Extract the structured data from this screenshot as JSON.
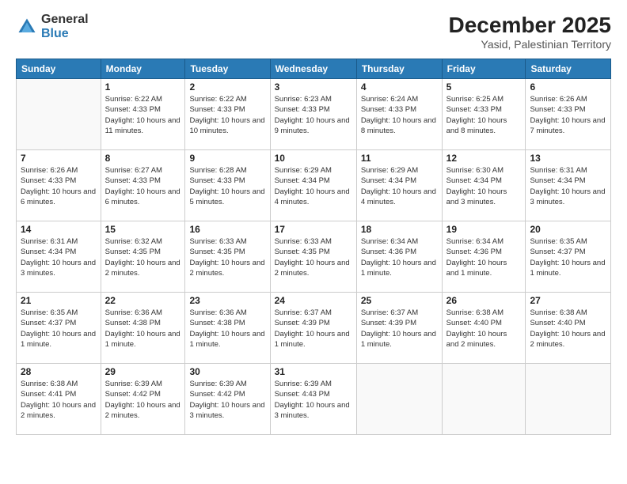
{
  "logo": {
    "general": "General",
    "blue": "Blue"
  },
  "title": "December 2025",
  "subtitle": "Yasid, Palestinian Territory",
  "days_of_week": [
    "Sunday",
    "Monday",
    "Tuesday",
    "Wednesday",
    "Thursday",
    "Friday",
    "Saturday"
  ],
  "weeks": [
    [
      {
        "day": "",
        "sunrise": "",
        "sunset": "",
        "daylight": ""
      },
      {
        "day": "1",
        "sunrise": "Sunrise: 6:22 AM",
        "sunset": "Sunset: 4:33 PM",
        "daylight": "Daylight: 10 hours and 11 minutes."
      },
      {
        "day": "2",
        "sunrise": "Sunrise: 6:22 AM",
        "sunset": "Sunset: 4:33 PM",
        "daylight": "Daylight: 10 hours and 10 minutes."
      },
      {
        "day": "3",
        "sunrise": "Sunrise: 6:23 AM",
        "sunset": "Sunset: 4:33 PM",
        "daylight": "Daylight: 10 hours and 9 minutes."
      },
      {
        "day": "4",
        "sunrise": "Sunrise: 6:24 AM",
        "sunset": "Sunset: 4:33 PM",
        "daylight": "Daylight: 10 hours and 8 minutes."
      },
      {
        "day": "5",
        "sunrise": "Sunrise: 6:25 AM",
        "sunset": "Sunset: 4:33 PM",
        "daylight": "Daylight: 10 hours and 8 minutes."
      },
      {
        "day": "6",
        "sunrise": "Sunrise: 6:26 AM",
        "sunset": "Sunset: 4:33 PM",
        "daylight": "Daylight: 10 hours and 7 minutes."
      }
    ],
    [
      {
        "day": "7",
        "sunrise": "Sunrise: 6:26 AM",
        "sunset": "Sunset: 4:33 PM",
        "daylight": "Daylight: 10 hours and 6 minutes."
      },
      {
        "day": "8",
        "sunrise": "Sunrise: 6:27 AM",
        "sunset": "Sunset: 4:33 PM",
        "daylight": "Daylight: 10 hours and 6 minutes."
      },
      {
        "day": "9",
        "sunrise": "Sunrise: 6:28 AM",
        "sunset": "Sunset: 4:33 PM",
        "daylight": "Daylight: 10 hours and 5 minutes."
      },
      {
        "day": "10",
        "sunrise": "Sunrise: 6:29 AM",
        "sunset": "Sunset: 4:34 PM",
        "daylight": "Daylight: 10 hours and 4 minutes."
      },
      {
        "day": "11",
        "sunrise": "Sunrise: 6:29 AM",
        "sunset": "Sunset: 4:34 PM",
        "daylight": "Daylight: 10 hours and 4 minutes."
      },
      {
        "day": "12",
        "sunrise": "Sunrise: 6:30 AM",
        "sunset": "Sunset: 4:34 PM",
        "daylight": "Daylight: 10 hours and 3 minutes."
      },
      {
        "day": "13",
        "sunrise": "Sunrise: 6:31 AM",
        "sunset": "Sunset: 4:34 PM",
        "daylight": "Daylight: 10 hours and 3 minutes."
      }
    ],
    [
      {
        "day": "14",
        "sunrise": "Sunrise: 6:31 AM",
        "sunset": "Sunset: 4:34 PM",
        "daylight": "Daylight: 10 hours and 3 minutes."
      },
      {
        "day": "15",
        "sunrise": "Sunrise: 6:32 AM",
        "sunset": "Sunset: 4:35 PM",
        "daylight": "Daylight: 10 hours and 2 minutes."
      },
      {
        "day": "16",
        "sunrise": "Sunrise: 6:33 AM",
        "sunset": "Sunset: 4:35 PM",
        "daylight": "Daylight: 10 hours and 2 minutes."
      },
      {
        "day": "17",
        "sunrise": "Sunrise: 6:33 AM",
        "sunset": "Sunset: 4:35 PM",
        "daylight": "Daylight: 10 hours and 2 minutes."
      },
      {
        "day": "18",
        "sunrise": "Sunrise: 6:34 AM",
        "sunset": "Sunset: 4:36 PM",
        "daylight": "Daylight: 10 hours and 1 minute."
      },
      {
        "day": "19",
        "sunrise": "Sunrise: 6:34 AM",
        "sunset": "Sunset: 4:36 PM",
        "daylight": "Daylight: 10 hours and 1 minute."
      },
      {
        "day": "20",
        "sunrise": "Sunrise: 6:35 AM",
        "sunset": "Sunset: 4:37 PM",
        "daylight": "Daylight: 10 hours and 1 minute."
      }
    ],
    [
      {
        "day": "21",
        "sunrise": "Sunrise: 6:35 AM",
        "sunset": "Sunset: 4:37 PM",
        "daylight": "Daylight: 10 hours and 1 minute."
      },
      {
        "day": "22",
        "sunrise": "Sunrise: 6:36 AM",
        "sunset": "Sunset: 4:38 PM",
        "daylight": "Daylight: 10 hours and 1 minute."
      },
      {
        "day": "23",
        "sunrise": "Sunrise: 6:36 AM",
        "sunset": "Sunset: 4:38 PM",
        "daylight": "Daylight: 10 hours and 1 minute."
      },
      {
        "day": "24",
        "sunrise": "Sunrise: 6:37 AM",
        "sunset": "Sunset: 4:39 PM",
        "daylight": "Daylight: 10 hours and 1 minute."
      },
      {
        "day": "25",
        "sunrise": "Sunrise: 6:37 AM",
        "sunset": "Sunset: 4:39 PM",
        "daylight": "Daylight: 10 hours and 1 minute."
      },
      {
        "day": "26",
        "sunrise": "Sunrise: 6:38 AM",
        "sunset": "Sunset: 4:40 PM",
        "daylight": "Daylight: 10 hours and 2 minutes."
      },
      {
        "day": "27",
        "sunrise": "Sunrise: 6:38 AM",
        "sunset": "Sunset: 4:40 PM",
        "daylight": "Daylight: 10 hours and 2 minutes."
      }
    ],
    [
      {
        "day": "28",
        "sunrise": "Sunrise: 6:38 AM",
        "sunset": "Sunset: 4:41 PM",
        "daylight": "Daylight: 10 hours and 2 minutes."
      },
      {
        "day": "29",
        "sunrise": "Sunrise: 6:39 AM",
        "sunset": "Sunset: 4:42 PM",
        "daylight": "Daylight: 10 hours and 2 minutes."
      },
      {
        "day": "30",
        "sunrise": "Sunrise: 6:39 AM",
        "sunset": "Sunset: 4:42 PM",
        "daylight": "Daylight: 10 hours and 3 minutes."
      },
      {
        "day": "31",
        "sunrise": "Sunrise: 6:39 AM",
        "sunset": "Sunset: 4:43 PM",
        "daylight": "Daylight: 10 hours and 3 minutes."
      },
      {
        "day": "",
        "sunrise": "",
        "sunset": "",
        "daylight": ""
      },
      {
        "day": "",
        "sunrise": "",
        "sunset": "",
        "daylight": ""
      },
      {
        "day": "",
        "sunrise": "",
        "sunset": "",
        "daylight": ""
      }
    ]
  ]
}
